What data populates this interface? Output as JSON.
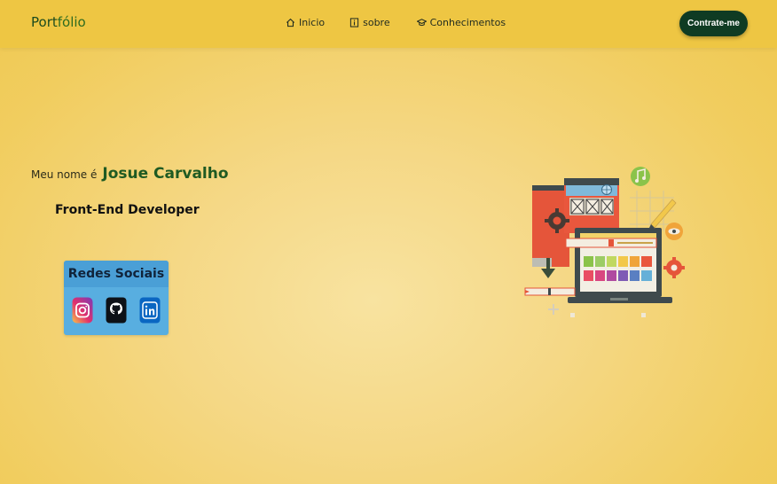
{
  "navbar": {
    "brand_part1": "Port",
    "brand_part2": "fólio",
    "links": [
      {
        "label": "Inicio",
        "icon": "home-icon"
      },
      {
        "label": "sobre",
        "icon": "info-icon"
      },
      {
        "label": "Conhecimentos",
        "icon": "graduation-cap-icon"
      }
    ],
    "cta_label": "Contrate-me"
  },
  "hero": {
    "intro_prefix": "Meu nome é",
    "name": "Josue Carvalho",
    "role": "Front-End Developer"
  },
  "social": {
    "title": "Redes Sociais",
    "icons": [
      "instagram-icon",
      "github-icon",
      "linkedin-icon"
    ]
  },
  "colors": {
    "navbar_bg": "#eec643",
    "page_bg": "#f5d886",
    "brand_green": "#1f5a22",
    "cta_bg": "#0f3b23",
    "social_card_bg": "#58aee0"
  }
}
